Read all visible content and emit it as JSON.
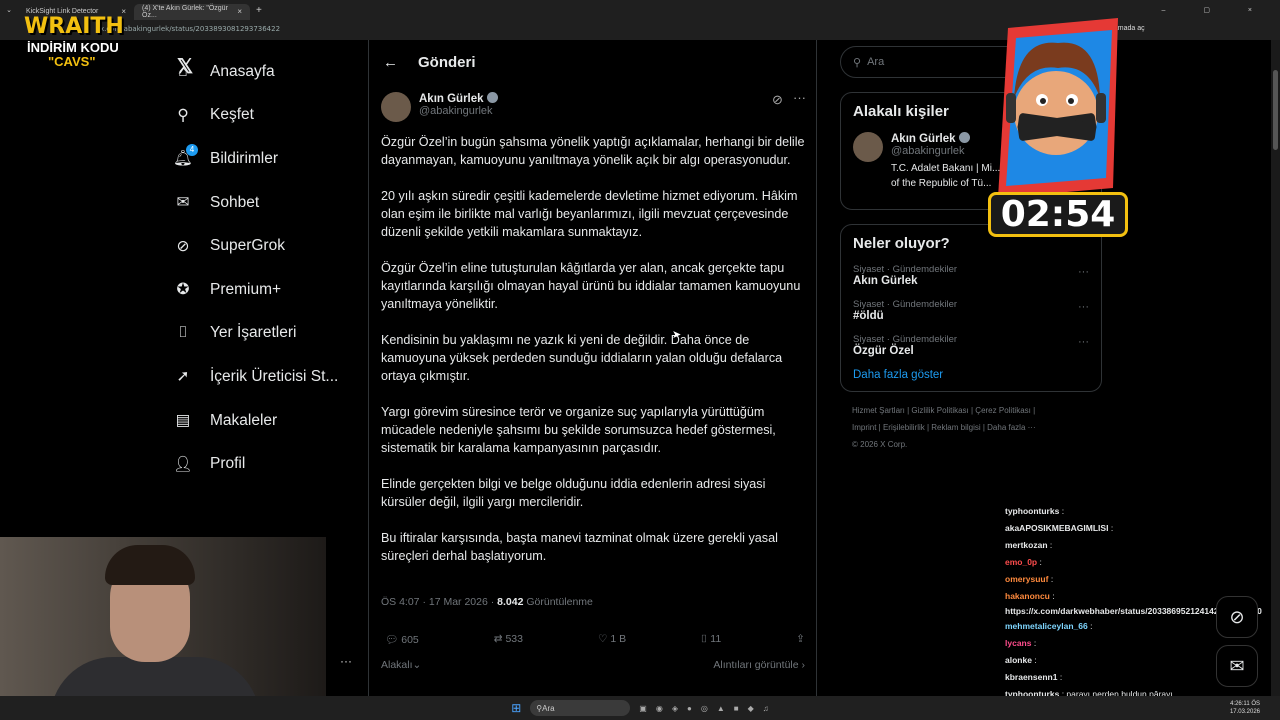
{
  "browser": {
    "tabs": [
      {
        "label": "KickSight Link Detector"
      },
      {
        "label": "(4) X'te Akın Gürlek: \"Özgür Öz..."
      }
    ],
    "url": "x.com/abakingurlek/status/2033893081293736422",
    "translate_chip": "Uygulamada aç"
  },
  "overlay": {
    "brand": "WRAITH",
    "discount": "İNDİRİM KODU",
    "code": "\"CAVS\"",
    "timer": "02:54"
  },
  "nav": {
    "items": [
      {
        "label": "Anasayfa",
        "icon": "home-icon"
      },
      {
        "label": "Keşfet",
        "icon": "search-icon"
      },
      {
        "label": "Bildirimler",
        "icon": "bell-icon",
        "badge": "4"
      },
      {
        "label": "Sohbet",
        "icon": "mail-icon"
      },
      {
        "label": "SuperGrok",
        "icon": "grok-icon"
      },
      {
        "label": "Premium+",
        "icon": "verified-icon"
      },
      {
        "label": "Yer İşaretleri",
        "icon": "bookmark-icon"
      },
      {
        "label": "İçerik Üreticisi St...",
        "icon": "rocket-icon"
      },
      {
        "label": "Makaleler",
        "icon": "article-icon"
      },
      {
        "label": "Profil",
        "icon": "person-icon"
      }
    ]
  },
  "post": {
    "header": "Gönderi",
    "author_name": "Akın Gürlek",
    "author_handle": "@abakingurlek",
    "paragraphs": [
      "Özgür Özel’in bugün şahsıma yönelik yaptığı açıklamalar, herhangi bir delile dayanmayan, kamuoyunu yanıltmaya yönelik açık bir algı operasyonudur.",
      "20 yılı aşkın süredir çeşitli kademelerde devletime hizmet ediyorum. Hâkim olan eşim ile birlikte mal varlığı beyanlarımızı, ilgili mevzuat çerçevesinde düzenli şekilde yetkili makamlara sunmaktayız.",
      "Özgür Özel’in eline tutuşturulan kâğıtlarda yer alan, ancak gerçekte tapu kayıtlarında karşılığı olmayan hayal ürünü bu iddialar tamamen kamuoyunu yanıltmaya yöneliktir.",
      "Kendisinin bu yaklaşımı ne yazık ki yeni de değildir. Daha önce de kamuoyuna yüksek perdeden sunduğu iddiaların yalan olduğu defalarca ortaya çıkmıştır.",
      "Yargı görevim süresince terör ve organize suç yapılarıyla yürüttüğüm mücadele nedeniyle şahsımı bu şekilde sorumsuzca hedef göstermesi, sistematik bir karalama kampanyasının parçasıdır.",
      "Elinde gerçekten bilgi ve belge olduğunu iddia edenlerin adresi siyasi kürsüler değil, ilgili yargı mercileridir.",
      "Bu iftiralar karşısında, başta manevi tazminat olmak üzere gerekli yasal süreçleri derhal başlatıyorum."
    ],
    "time": "ÖS 4:07 · 17 Mar 2026 · ",
    "views_count": "8.042",
    "views_label": " Görüntülenme",
    "replies": "605",
    "reposts": "533",
    "likes": "1 B",
    "bookmarks": "11",
    "related": "Alakalı",
    "quotes": "Alıntıları görüntüle"
  },
  "sidebar": {
    "search_placeholder": "Ara",
    "related_title": "Alakalı kişiler",
    "person_name": "Akın Gürlek",
    "person_handle": "@abakingurlek",
    "person_bio": "T.C. Adalet Bakanı | Mi... of the Republic of Tü...",
    "trends_title": "Neler oluyor?",
    "trends": [
      {
        "cat": "Siyaset · Gündemdekiler",
        "title": "Akın Gürlek"
      },
      {
        "cat": "Siyaset · Gündemdekiler",
        "title": "#öldü"
      },
      {
        "cat": "Siyaset · Gündemdekiler",
        "title": "Özgür Özel"
      }
    ],
    "show_more": "Daha fazla göster",
    "footer_lines": [
      "Hizmet Şartları  |  Gizlilik Politikası  |  Çerez Politikası  |",
      "Imprint  |  Erişilebilirlik  |  Reklam bilgisi  |  Daha fazla ···",
      "© 2026 X Corp."
    ]
  },
  "chat": [
    {
      "user": "typhoonturks",
      "msg": ":",
      "color": "#e7e9ea"
    },
    {
      "user": "akaAPOSIKMEBAGIMLISI",
      "msg": ":",
      "color": "#e7e9ea"
    },
    {
      "user": "mertkozan",
      "msg": ":",
      "color": "#e7e9ea"
    },
    {
      "user": "emo_0p",
      "msg": ":",
      "color": "#ff4d4d"
    },
    {
      "user": "omerysuuf",
      "msg": ":",
      "color": "#ff8a3d"
    },
    {
      "user": "hakanoncu",
      "msg": ":",
      "color": "#ff8a3d"
    },
    {
      "user": "",
      "msg": "https://x.com/darkwebhaber/status/2033869521241428427?s=20",
      "color": "#e7e9ea"
    },
    {
      "user": "mehmetaliceylan_66",
      "msg": ":",
      "color": "#7fd6ff"
    },
    {
      "user": "lycans",
      "msg": ":",
      "color": "#ff4d8d"
    },
    {
      "user": "alonke",
      "msg": ":",
      "color": "#e7e9ea"
    },
    {
      "user": "kbraensenn1",
      "msg": ":",
      "color": "#e7e9ea"
    },
    {
      "user": "typhoonturks",
      "msg": ": parayı nerden buldun pârayı",
      "color": "#e7e9ea"
    }
  ],
  "taskbar": {
    "search": "Ara",
    "time": "4:26:11 ÖS",
    "date": "17.03.2026"
  }
}
